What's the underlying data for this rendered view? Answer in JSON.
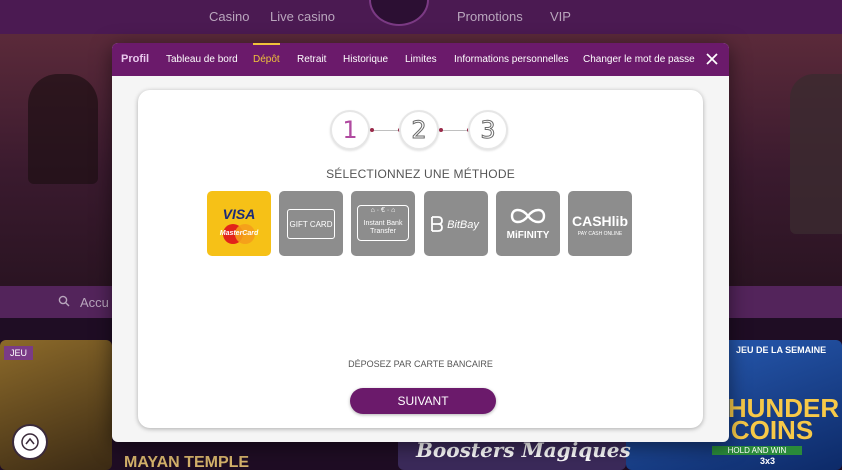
{
  "top_nav": {
    "items": [
      "Casino",
      "Live casino",
      "Promotions",
      "VIP"
    ]
  },
  "search": {
    "placeholder": "Accu"
  },
  "games": {
    "badge_left": "JEU",
    "badge_right": "JEU DE LA SEMAINE",
    "title_left": "MAYAN TEMPLE",
    "title_mid": "Boosters Magiques",
    "title_right": "THUNDER COINS",
    "subtitle_right": "HOLD AND WIN",
    "subtitle_right_multiplier": "3x3"
  },
  "modal": {
    "tabs": [
      {
        "label": "Profil",
        "type": "title"
      },
      {
        "label": "Tableau de bord"
      },
      {
        "label": "Dépôt",
        "active": true
      },
      {
        "label": "Retrait"
      },
      {
        "label": "Historique"
      },
      {
        "label": "Limites"
      },
      {
        "label": "Informations personnelles"
      },
      {
        "label": "Changer le mot de passe"
      }
    ],
    "steps": [
      "1",
      "2",
      "3"
    ],
    "current_step": 1,
    "section_title": "SÉLECTIONNEZ UNE MÉTHODE",
    "methods": [
      {
        "label": "VISA",
        "sublabel": "MasterCard",
        "selected": true
      },
      {
        "label": "GIFT CARD"
      },
      {
        "label": "Instant Bank Transfer"
      },
      {
        "label": "BitBay"
      },
      {
        "label": "MiFINITY"
      },
      {
        "label": "CASHlib",
        "sublabel": "PAY CASH ONLINE"
      }
    ],
    "hint": "DÉPOSEZ PAR CARTE BANCAIRE",
    "submit_label": "SUIVANT"
  },
  "colors": {
    "tab_bar": "#6b1a6b",
    "accent": "#f0c23b",
    "selected_method": "#f6c117",
    "method": "#8d8d8d",
    "step_active": "#b04aa0"
  }
}
